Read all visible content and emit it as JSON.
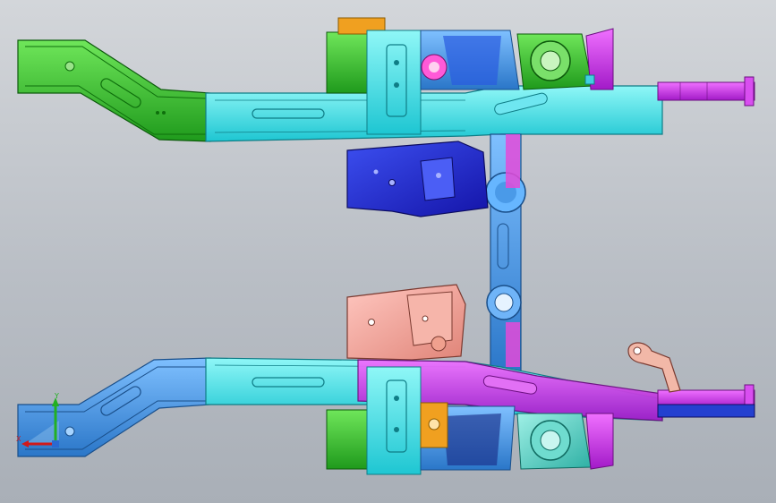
{
  "viewport": {
    "background_top": "#d3d6da",
    "background_bottom": "#a9afb7"
  },
  "triad": {
    "x_label": "X",
    "y_label": "Y",
    "x_color": "#d11a1a",
    "y_color": "#22b022",
    "z_color": "#2a6ad1"
  },
  "parts": {
    "front_rail_extension": "#2fb52a",
    "rail_main_section": "#35e0e6",
    "rail_lower": "#3a8fe0",
    "cross_member": "#5aa9e8",
    "suspension_bracket": "#1f2fcf",
    "tower_reinforcement": "#f08bd8",
    "rail_rear_outrigger": "#c020e8",
    "mount_plate": "#f2a9a0",
    "shock_tower": "#49c8b8",
    "small_bracket": "#f0a020"
  }
}
